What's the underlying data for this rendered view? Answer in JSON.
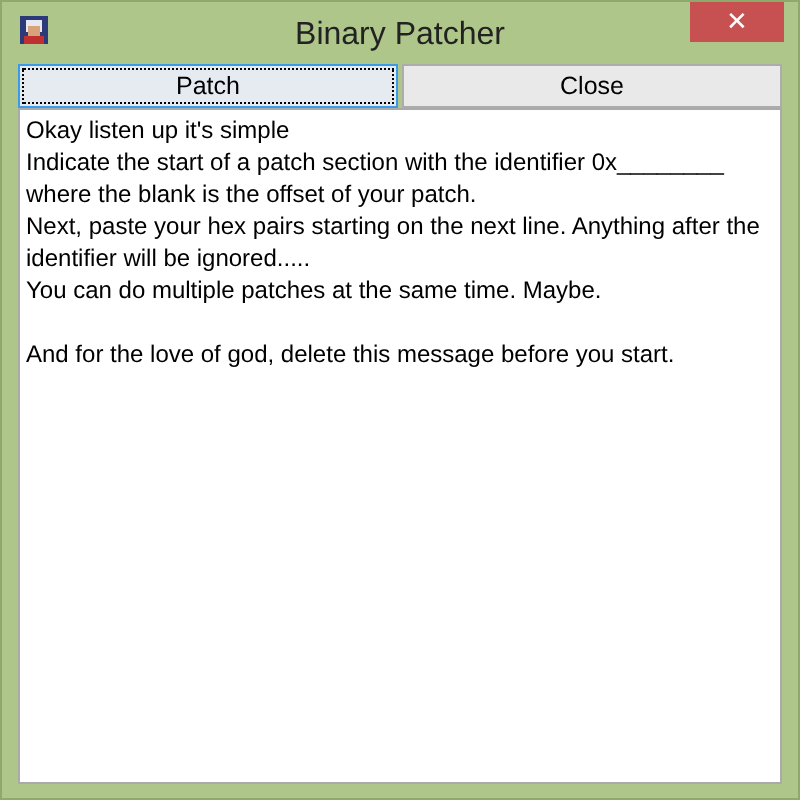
{
  "window": {
    "title": "Binary Patcher",
    "close_glyph": "✕"
  },
  "buttons": [
    {
      "label": "Patch",
      "focused": true
    },
    {
      "label": "Close",
      "focused": false
    }
  ],
  "text_area": {
    "blank_line_before_last": true,
    "lines": [
      "Okay listen up it's simple",
      "Indicate the start of a patch section with the identifier 0x________",
      "where the blank is the offset of your patch.",
      "Next, paste your hex pairs starting on the next line. Anything after the identifier will be ignored.....",
      "You can do multiple patches at the same time. Maybe.",
      "And for the love of god, delete this message before you start."
    ]
  }
}
